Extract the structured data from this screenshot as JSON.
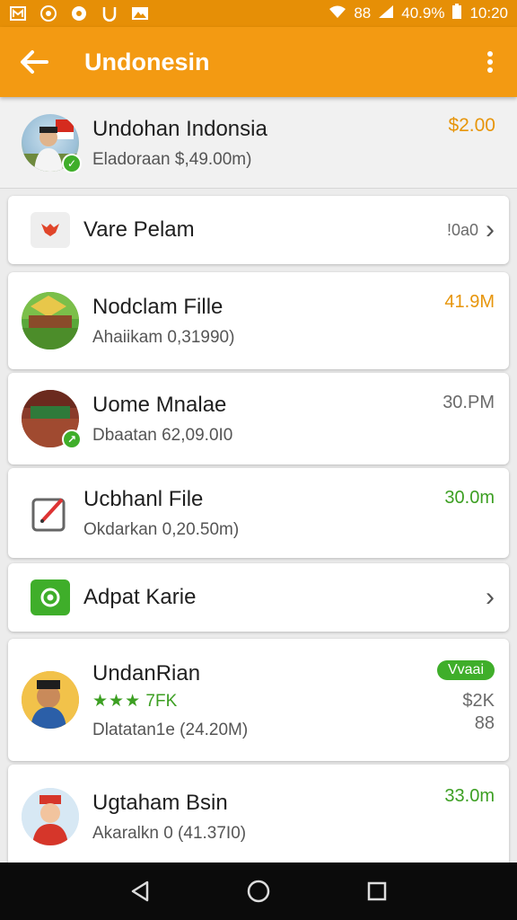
{
  "status_bar": {
    "icons_left": [
      "message-icon",
      "camera-icon",
      "record-icon",
      "shield-icon",
      "photo-icon"
    ],
    "signal_text": "88",
    "battery": "40.9%",
    "time": "10:20"
  },
  "app_bar": {
    "title": "Undonesin"
  },
  "header_item": {
    "title": "Undohan Indonsia",
    "subtitle": "Eladoraan $,49.00m)",
    "amount": "$2.00"
  },
  "items": [
    {
      "title": "Vare Pelam",
      "value": "!0a0"
    },
    {
      "title": "Nodclam Fille",
      "subtitle": "Ahaiikam 0,31990)",
      "amount": "41.9M"
    },
    {
      "title": "Uome Mnalae",
      "subtitle": "Dbaatan 62,09.0I0",
      "amount": "30.PM"
    },
    {
      "title": "Ucbhanl File",
      "subtitle": "Okdarkan 0,20.50m)",
      "amount": "30.0m"
    },
    {
      "title": "Adpat Karie"
    },
    {
      "title": "UndanRian",
      "rating_stars": "★★★",
      "rating_text": "7FK",
      "subtitle": "Dlatatan1e (24.20M)",
      "badge": "Vvaai",
      "amount": "$2K",
      "amount2": "88"
    },
    {
      "title": "Ugtaham Bsin",
      "subtitle": "Akaralkn 0 (41.37I0)",
      "amount": "33.0m"
    }
  ],
  "colors": {
    "status_bar": "#e68f06",
    "app_bar": "#f39a12",
    "accent_green": "#3fae2a",
    "amount_orange": "#e7950a"
  }
}
